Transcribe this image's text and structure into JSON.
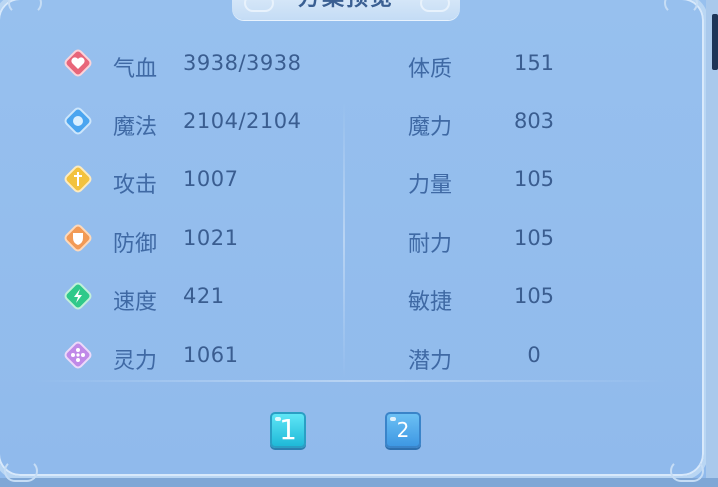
{
  "panel": {
    "title": "方案预览",
    "colors": {
      "background": "#92bbeb",
      "label": "#3f69a4",
      "value": "#3a5d90",
      "active_page": "#2fc9e4",
      "inactive_page": "#4ea6ea"
    }
  },
  "stats": [
    {
      "label": "气血",
      "value": "3938/3938",
      "icon": "heart-icon",
      "color": "#e8667a"
    },
    {
      "label": "魔法",
      "value": "2104/2104",
      "icon": "mana-icon",
      "color": "#4aa5f0"
    },
    {
      "label": "攻击",
      "value": "1007",
      "icon": "sword-icon",
      "color": "#f2c23e"
    },
    {
      "label": "防御",
      "value": "1021",
      "icon": "shield-icon",
      "color": "#f29a55"
    },
    {
      "label": "速度",
      "value": "421",
      "icon": "lightning-icon",
      "color": "#2fc98a"
    },
    {
      "label": "灵力",
      "value": "1061",
      "icon": "spirit-icon",
      "color": "#c08ae8"
    }
  ],
  "attributes": [
    {
      "label": "体质",
      "value": "151"
    },
    {
      "label": "魔力",
      "value": "803"
    },
    {
      "label": "力量",
      "value": "105"
    },
    {
      "label": "耐力",
      "value": "105"
    },
    {
      "label": "敏捷",
      "value": "105"
    },
    {
      "label": "潜力",
      "value": "0"
    }
  ],
  "pagination": {
    "pages": [
      "1",
      "2"
    ],
    "active": "1"
  }
}
